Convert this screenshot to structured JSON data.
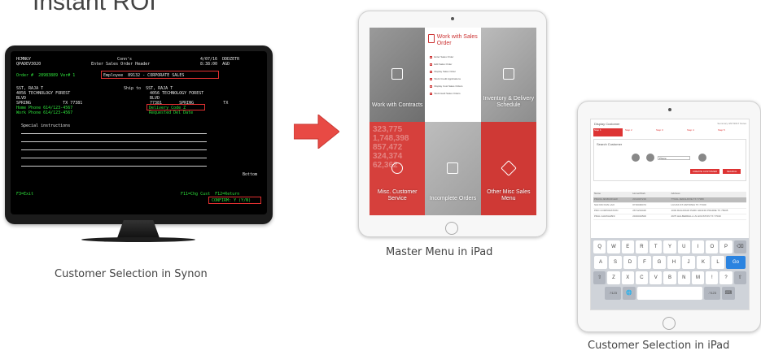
{
  "page_title": "Instant ROI",
  "arrow_color": "#e84a44",
  "synon": {
    "caption": "Customer Selection in  Synon",
    "lines": [
      {
        "left": "HCMNGY",
        "mid": "Conn's",
        "right": "4/07/16  DDDZETR"
      },
      {
        "left": "QPADEV3020",
        "mid": "Enter Sales Order Header",
        "right": "8:38:00  AGD"
      },
      {
        "text": "Order #  28983889 Ver# 1"
      },
      {
        "text": "Employee  89132 - CORPORATE SALES"
      },
      {
        "text": "SST, RAJA T"
      },
      {
        "text": "Ship to  SST, RAJA T"
      },
      {
        "text": "4056 TECHNOLOGY FOREST"
      },
      {
        "text": "4056 TECHNOLOGY FOREST"
      },
      {
        "text": "BLVD"
      },
      {
        "text": "BLVD"
      },
      {
        "text": "SPRING             TX 77381"
      },
      {
        "text": "77381       SPRING            TX"
      },
      {
        "text": "Home Phone 614/123-4567"
      },
      {
        "text": "Delivery Code Z"
      },
      {
        "text": "Work Phone 614/123-4567"
      },
      {
        "text": "Requested Del Date"
      },
      {
        "text": "Special instructions"
      },
      {
        "text": "Bottom"
      },
      {
        "text": "F3=Exit"
      },
      {
        "text": "F11=Chg Cust  F12=Return"
      },
      {
        "text": "CONFIRM: Y (Y/N)"
      }
    ]
  },
  "master_menu": {
    "caption": "Master Menu in iPad",
    "tiles": [
      {
        "label": "Work with Contracts"
      },
      {
        "label": "Work with Sales Order",
        "items": [
          "Enter Sales Order",
          "Edit Sales Order",
          "Display Sales Order",
          "Work Credit Applications",
          "Display Cust Sales Orders",
          "Work Held Sales Orders"
        ]
      },
      {
        "label": "Inventory & Delivery Schedule"
      },
      {
        "label": "Misc. Customer Service",
        "numbers": [
          "323,775",
          "1,748,398",
          "857,472",
          "324,374",
          "62,362"
        ]
      },
      {
        "label": "Incomplete Orders"
      },
      {
        "label": "Other Misc Sales Menu"
      }
    ]
  },
  "customer_ipad": {
    "caption": "Customer Selection in iPad",
    "screen_title": "Display Customer",
    "header_icons": "Summary  3/07/2017  Notes",
    "steps": [
      "Step 1",
      "Step 2",
      "Step 3",
      "Step 4",
      "Step 5"
    ],
    "search_title": "Search Customer",
    "search_value": "Phone",
    "create_button": "CREATE CUSTOMER",
    "search_button": "SEARCH",
    "table_headers": [
      "Name",
      "Home/Work",
      "Address"
    ],
    "table_rows": [
      [
        "PRAVA JESBURGER",
        "2314467219",
        "7TOAL JERALDIXE TX 77380"
      ],
      [
        "SALYAN FAN LAO",
        "0716436474",
        "LUCAS ST ANTIONIA TX 77100"
      ],
      [
        "PRO CORPORATION",
        "2671234420",
        "1003 RAILROAD PARK  GRAND PRAIRIE TX 75005"
      ],
      [
        "PRAL GAVDALBNI",
        "2016434500",
        "4975 HALBERDALL LN HOUSTON TX 77040"
      ]
    ],
    "keyboard": [
      [
        "Q",
        "W",
        "E",
        "R",
        "T",
        "Y",
        "U",
        "I",
        "O",
        "P",
        "⌫"
      ],
      [
        "A",
        "S",
        "D",
        "F",
        "G",
        "H",
        "J",
        "K",
        "L",
        "Go"
      ],
      [
        "⇧",
        "Z",
        "X",
        "C",
        "V",
        "B",
        "N",
        "M",
        "!",
        "?",
        "⇧"
      ],
      [
        ".?123",
        "🌐",
        "",
        ".?123",
        "⌨"
      ]
    ]
  }
}
